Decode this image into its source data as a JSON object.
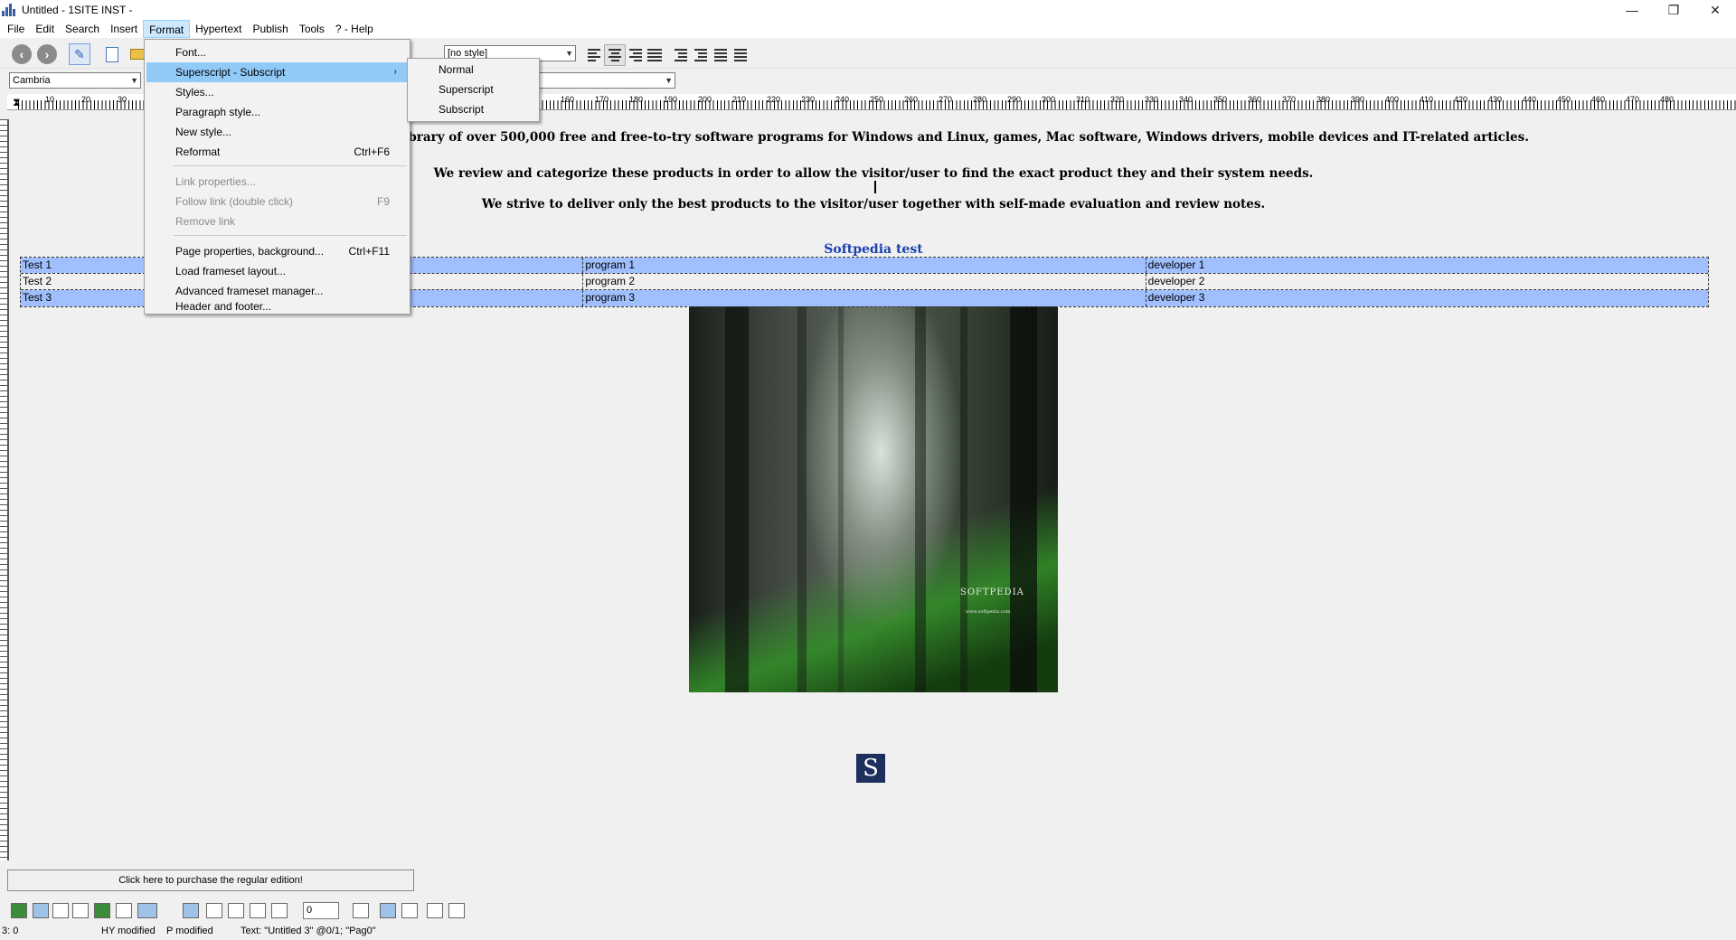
{
  "window": {
    "title": "Untitled - 1SITE INST -",
    "minimize": "—",
    "restore": "❐",
    "close": "✕"
  },
  "menubar": {
    "items": [
      "File",
      "Edit",
      "Search",
      "Insert",
      "Format",
      "Hypertext",
      "Publish",
      "Tools",
      "? - Help"
    ],
    "active": "Format"
  },
  "toolbar": {
    "style_select": "[no style]",
    "font_select": "Cambria",
    "size_select": ""
  },
  "ruler": {
    "labels": [
      "10",
      "20",
      "30",
      "160",
      "170",
      "180",
      "190",
      "200",
      "210",
      "220",
      "230",
      "240",
      "250",
      "260",
      "270",
      "280",
      "290",
      "300",
      "310",
      "320",
      "330",
      "340",
      "350",
      "360",
      "370",
      "380",
      "390",
      "400",
      "410",
      "420",
      "430",
      "440",
      "450",
      "460",
      "470",
      "480"
    ]
  },
  "document": {
    "paragraph1": "library of over 500,000 free and free-to-try software programs for Windows and Linux, games, Mac software, Windows drivers, mobile devices and IT-related articles.",
    "paragraph2": "We review and categorize these products in order to allow the visitor/user to find the exact product they and their system needs.",
    "paragraph3": "We strive to deliver only the best products to the visitor/user together with self-made evaluation and review notes.",
    "table_title": "Softpedia test",
    "table_rows": [
      [
        "Test 1",
        "program 1",
        "developer 1"
      ],
      [
        "Test 2",
        "program 2",
        "developer 2"
      ],
      [
        "Test 3",
        "program 3",
        "developer 3"
      ]
    ],
    "image_brand": "SOFTPEDIA",
    "image_url_text": "www.softpedia.com",
    "logo_letter": "S"
  },
  "purchase_button": "Click here to purchase the regular edition!",
  "bottom_toolbar": {
    "spin_value": "0"
  },
  "statusbar": {
    "position": "3: 0",
    "hy": "HY modified",
    "p": "P modified",
    "text": "Text: \"Untitled 3\" @0/1; \"Pag0\""
  },
  "format_menu": {
    "items": [
      {
        "label": "Font...",
        "shortcut": ""
      },
      {
        "label": "Superscript - Subscript",
        "shortcut": "",
        "submenu": true
      },
      {
        "label": "Styles...",
        "shortcut": ""
      },
      {
        "label": "Paragraph style...",
        "shortcut": ""
      },
      {
        "label": "New style...",
        "shortcut": ""
      },
      {
        "label": "Reformat",
        "shortcut": "Ctrl+F6"
      },
      {
        "label": "Link properties...",
        "shortcut": "",
        "disabled": true
      },
      {
        "label": "Follow link (double click)",
        "shortcut": "F9",
        "disabled": true
      },
      {
        "label": "Remove link",
        "shortcut": "",
        "disabled": true
      },
      {
        "label": "Page properties, background...",
        "shortcut": "Ctrl+F11"
      },
      {
        "label": "Load frameset layout...",
        "shortcut": ""
      },
      {
        "label": "Advanced frameset manager...",
        "shortcut": ""
      },
      {
        "label": "Header and footer...",
        "shortcut": ""
      }
    ]
  },
  "sub_menu": {
    "items": [
      "Normal",
      "Superscript",
      "Subscript"
    ]
  },
  "icons": [
    "back-icon",
    "forward-icon",
    "edit-icon",
    "new-document-icon",
    "open-folder-icon",
    "align-left-icon",
    "align-center-icon",
    "align-right-icon",
    "justify-icon",
    "outdent-icon",
    "indent-icon",
    "bullet-list-icon",
    "numbered-list-icon"
  ]
}
